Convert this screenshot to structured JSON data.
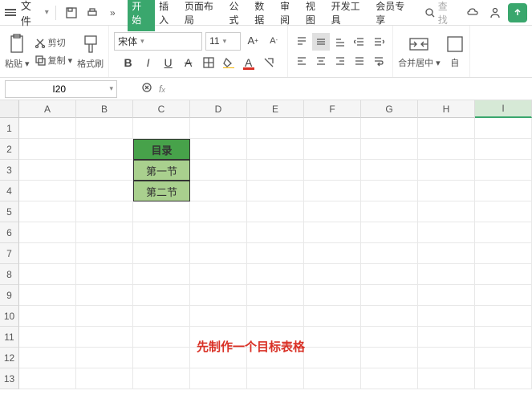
{
  "titlebar": {
    "file": "文件",
    "tabs": [
      "开始",
      "插入",
      "页面布局",
      "公式",
      "数据",
      "审阅",
      "视图",
      "开发工具",
      "会员专享"
    ],
    "active_tab": 0,
    "search_label": "查找"
  },
  "ribbon": {
    "paste": "粘贴",
    "cut": "剪切",
    "copy": "复制",
    "format_painter": "格式刷",
    "font_name": "宋体",
    "font_size": "11",
    "merge": "合并居中",
    "auto": "自"
  },
  "namebox": {
    "value": "I20"
  },
  "sheet": {
    "columns": [
      "A",
      "B",
      "C",
      "D",
      "E",
      "F",
      "G",
      "H",
      "I"
    ],
    "rows": [
      "1",
      "2",
      "3",
      "4",
      "5",
      "6",
      "7",
      "8",
      "9",
      "10",
      "11",
      "12",
      "13"
    ],
    "selected_col": "I",
    "cells": {
      "C2": {
        "text": "目录",
        "style": "header-green"
      },
      "C3": {
        "text": "第一节",
        "style": "light-green"
      },
      "C4": {
        "text": "第二节",
        "style": "light-green"
      }
    }
  },
  "annotation": "先制作一个目标表格",
  "chart_data": null
}
